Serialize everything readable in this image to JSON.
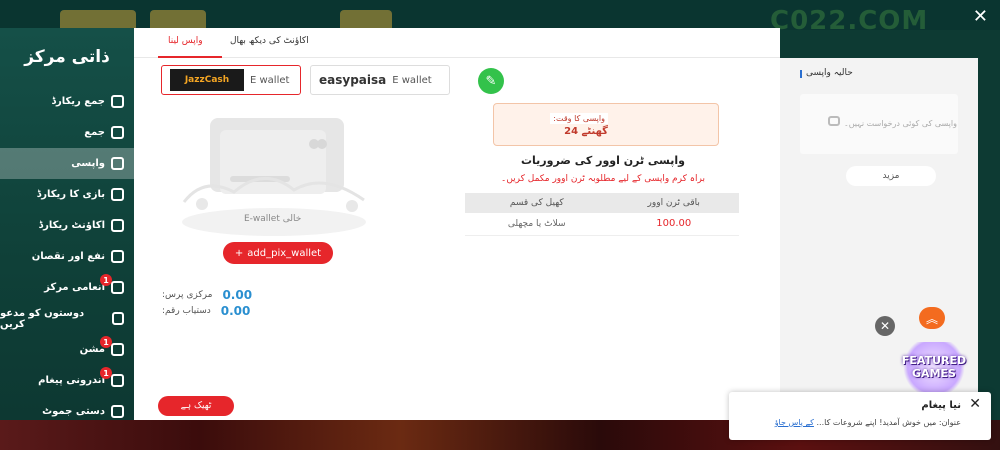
{
  "background": {
    "brand": "C022.COM",
    "close": "✕"
  },
  "sidebar": {
    "title": "ذاتی مرکز",
    "items": [
      {
        "label": "جمع ریکارڈ",
        "icon": "deposit-record-icon"
      },
      {
        "label": "جمع",
        "icon": "deposit-icon"
      },
      {
        "label": "واپسی",
        "icon": "withdraw-icon",
        "active": true
      },
      {
        "label": "بازی کا ریکارڈ",
        "icon": "game-record-icon"
      },
      {
        "label": "اکاؤنٹ ریکارڈ",
        "icon": "account-record-icon"
      },
      {
        "label": "نفع اور نقصان",
        "icon": "profit-loss-icon"
      },
      {
        "label": "انعامی مرکز",
        "icon": "reward-center-icon",
        "badge": "1"
      },
      {
        "label": "دوستوں کو مدعو کریں",
        "icon": "invite-friends-icon"
      },
      {
        "label": "مشن",
        "icon": "mission-icon",
        "badge": "1"
      },
      {
        "label": "اندرونی پیغام",
        "icon": "message-icon",
        "badge": "1"
      },
      {
        "label": "دستی جموٹ",
        "icon": "manual-icon"
      }
    ]
  },
  "tabs": {
    "withdraw": "واپس لینا",
    "account": "اکاؤنٹ کی دیکھ بھال"
  },
  "wallets": {
    "jazzcash_logo": "JazzCash",
    "jazzcash_type": "E wallet",
    "easypaisa_logo": "easypaisa",
    "easypaisa_type": "E wallet"
  },
  "empty": {
    "label": "E-wallet خالی"
  },
  "add_button": "add_pix_wallet",
  "balances": {
    "center_label": ":مرکزی پرس",
    "center_value": "0.00",
    "available_label": ":دستیاب رقم",
    "available_value": "0.00"
  },
  "ok_button": "ٹھیک ہے",
  "withdraw_time": {
    "label": ":واپسی کا وقت",
    "value": "24 گھنٹے"
  },
  "requirements": {
    "title": "واپسی ٹرن اوور کی ضروریات",
    "note": "براہ کرم واپسی کے لیے مطلوبہ ٹرن اوور مکمل کریں۔",
    "headers": [
      "کھیل کی قسم",
      "باقی ٹرن اوور"
    ],
    "rows": [
      {
        "game_type": "سلاٹ یا مچھلی",
        "remaining": "100.00"
      }
    ]
  },
  "recent": {
    "title": "حالیہ واپسی",
    "empty_text": "واپسی کی کوئی درخواست نہیں۔",
    "more": "مزید"
  },
  "featured": {
    "line1": "FEATURED",
    "line2": "GAMES"
  },
  "message_popup": {
    "title": "نیا پیغام",
    "body": "عنوان: میں خوش آمدید! اپنے شروعات کا...",
    "link": "کے پاس جاؤ",
    "close": "✕"
  },
  "colors": {
    "accent_red": "#e6262b",
    "sidebar_green": "#155048",
    "value_blue": "#2a8fd0",
    "edit_green": "#33c24b"
  }
}
